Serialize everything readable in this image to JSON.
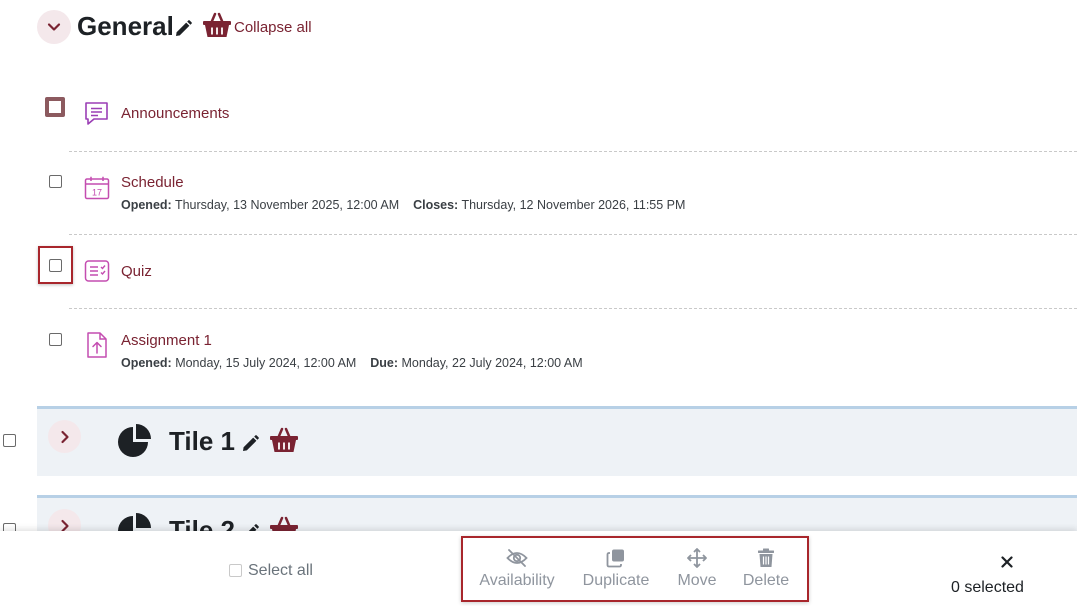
{
  "section": {
    "title": "General",
    "collapse_all": "Collapse all"
  },
  "activities": [
    {
      "name": "Announcements",
      "icon": "forum-icon"
    },
    {
      "name": "Schedule",
      "icon": "calendar-icon",
      "dates": [
        {
          "label": "Opened:",
          "value": "Thursday, 13 November 2025, 12:00 AM"
        },
        {
          "label": "Closes:",
          "value": "Thursday, 12 November 2026, 11:55 PM"
        }
      ]
    },
    {
      "name": "Quiz",
      "icon": "quiz-icon"
    },
    {
      "name": "Assignment 1",
      "icon": "assignment-icon",
      "dates": [
        {
          "label": "Opened:",
          "value": "Monday, 15 July 2024, 12:00 AM"
        },
        {
          "label": "Due:",
          "value": "Monday, 22 July 2024, 12:00 AM"
        }
      ]
    }
  ],
  "calendar_day": "17",
  "tiles": [
    {
      "title": "Tile 1"
    },
    {
      "title": "Tile 2"
    }
  ],
  "footer": {
    "select_all": "Select all",
    "actions": {
      "availability": "Availability",
      "duplicate": "Duplicate",
      "move": "Move",
      "delete": "Delete"
    },
    "selected_count": "0 selected"
  },
  "colors": {
    "link": "#7a2332",
    "highlight": "#a8262c",
    "tile_bg": "#eef2f6",
    "tile_border": "#b7d0e6",
    "activity_icon": "#b02a8f"
  }
}
